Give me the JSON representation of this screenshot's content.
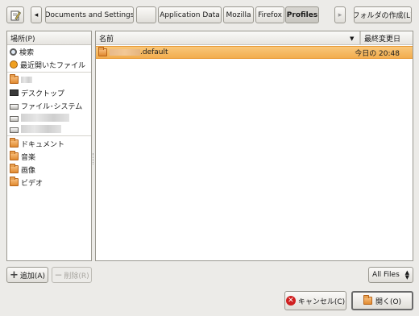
{
  "toolbar": {
    "crumbs": [
      "Documents and Settings",
      "",
      "Application Data",
      "Mozilla",
      "Firefox",
      "Profiles"
    ],
    "create_folder": "フォルダの作成(L)"
  },
  "places": {
    "header": "場所(P)",
    "search": "検索",
    "recent": "最近開いたファイル",
    "desktop": "デスクトップ",
    "filesystem": "ファイル･システム",
    "documents": "ドキュメント",
    "music": "音楽",
    "pictures": "画像",
    "video": "ビデオ"
  },
  "files": {
    "col_name": "名前",
    "col_modified": "最終変更日",
    "rows": [
      {
        "name": ".default",
        "modified": "今日の 20:48"
      }
    ]
  },
  "bottom": {
    "add": "追加(A)",
    "remove": "削除(R)",
    "filter": "All Files",
    "cancel": "キャンセル(C)",
    "open": "開く(O)"
  }
}
